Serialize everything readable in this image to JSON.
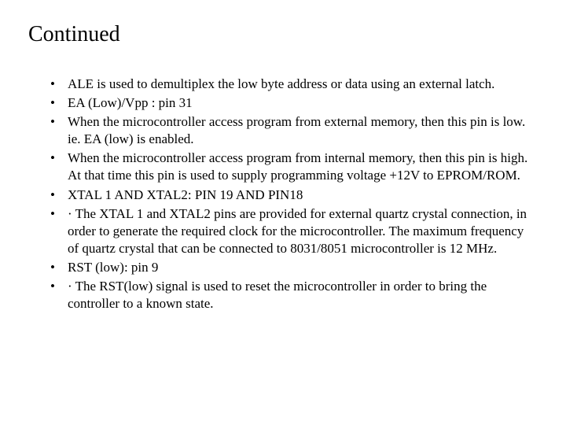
{
  "title": "Continued",
  "bullets": [
    "ALE is used to demultiplex the low byte address or data using an external latch.",
    "EA (Low)/Vpp : pin 31",
    "When the microcontroller access program from external memory, then this pin is low. ie. EA (low) is enabled.",
    "When the microcontroller access program from internal memory, then this pin is high. At that time this  pin is used to supply programming voltage +12V to EPROM/ROM.",
    "XTAL 1 AND XTAL2: PIN 19 AND PIN18",
    "· The XTAL 1 and XTAL2 pins are provided for external quartz crystal connection, in order to generate the required clock for the microcontroller. The maximum frequency of quartz crystal that can be connected to 8031/8051 microcontroller is 12 MHz.",
    "RST (low): pin 9",
    "· The RST(low) signal is used to reset the microcontroller in order to bring the controller to a known state."
  ]
}
